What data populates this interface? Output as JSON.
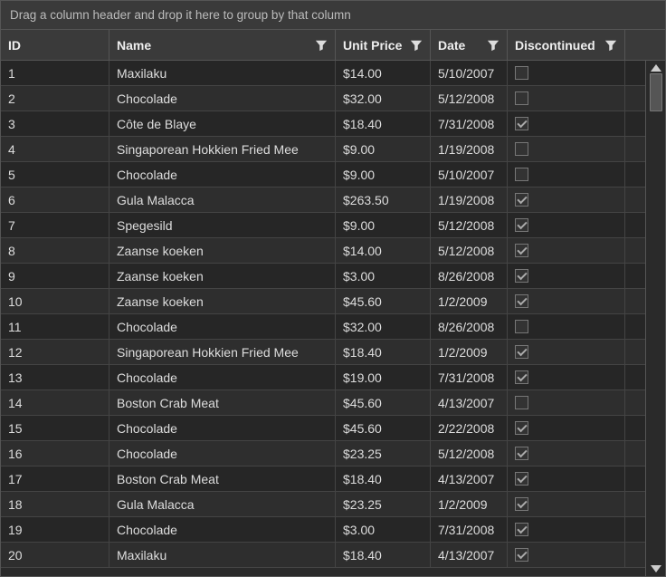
{
  "groupPanel": {
    "text": "Drag a column header and drop it here to group by that column"
  },
  "columns": {
    "id": {
      "header": "ID"
    },
    "name": {
      "header": "Name"
    },
    "price": {
      "header": "Unit Price"
    },
    "date": {
      "header": "Date"
    },
    "disc": {
      "header": "Discontinued"
    }
  },
  "rows": [
    {
      "id": "1",
      "name": "Maxilaku",
      "price": "$14.00",
      "date": "5/10/2007",
      "disc": false
    },
    {
      "id": "2",
      "name": "Chocolade",
      "price": "$32.00",
      "date": "5/12/2008",
      "disc": false
    },
    {
      "id": "3",
      "name": "Côte de Blaye",
      "price": "$18.40",
      "date": "7/31/2008",
      "disc": true
    },
    {
      "id": "4",
      "name": "Singaporean Hokkien Fried Mee",
      "price": "$9.00",
      "date": "1/19/2008",
      "disc": false
    },
    {
      "id": "5",
      "name": "Chocolade",
      "price": "$9.00",
      "date": "5/10/2007",
      "disc": false
    },
    {
      "id": "6",
      "name": "Gula Malacca",
      "price": "$263.50",
      "date": "1/19/2008",
      "disc": true
    },
    {
      "id": "7",
      "name": "Spegesild",
      "price": "$9.00",
      "date": "5/12/2008",
      "disc": true
    },
    {
      "id": "8",
      "name": "Zaanse koeken",
      "price": "$14.00",
      "date": "5/12/2008",
      "disc": true
    },
    {
      "id": "9",
      "name": "Zaanse koeken",
      "price": "$3.00",
      "date": "8/26/2008",
      "disc": true
    },
    {
      "id": "10",
      "name": "Zaanse koeken",
      "price": "$45.60",
      "date": "1/2/2009",
      "disc": true
    },
    {
      "id": "11",
      "name": "Chocolade",
      "price": "$32.00",
      "date": "8/26/2008",
      "disc": false
    },
    {
      "id": "12",
      "name": "Singaporean Hokkien Fried Mee",
      "price": "$18.40",
      "date": "1/2/2009",
      "disc": true
    },
    {
      "id": "13",
      "name": "Chocolade",
      "price": "$19.00",
      "date": "7/31/2008",
      "disc": true
    },
    {
      "id": "14",
      "name": "Boston Crab Meat",
      "price": "$45.60",
      "date": "4/13/2007",
      "disc": false
    },
    {
      "id": "15",
      "name": "Chocolade",
      "price": "$45.60",
      "date": "2/22/2008",
      "disc": true
    },
    {
      "id": "16",
      "name": "Chocolade",
      "price": "$23.25",
      "date": "5/12/2008",
      "disc": true
    },
    {
      "id": "17",
      "name": "Boston Crab Meat",
      "price": "$18.40",
      "date": "4/13/2007",
      "disc": true
    },
    {
      "id": "18",
      "name": "Gula Malacca",
      "price": "$23.25",
      "date": "1/2/2009",
      "disc": true
    },
    {
      "id": "19",
      "name": "Chocolade",
      "price": "$3.00",
      "date": "7/31/2008",
      "disc": true
    },
    {
      "id": "20",
      "name": "Maxilaku",
      "price": "$18.40",
      "date": "4/13/2007",
      "disc": true
    }
  ]
}
